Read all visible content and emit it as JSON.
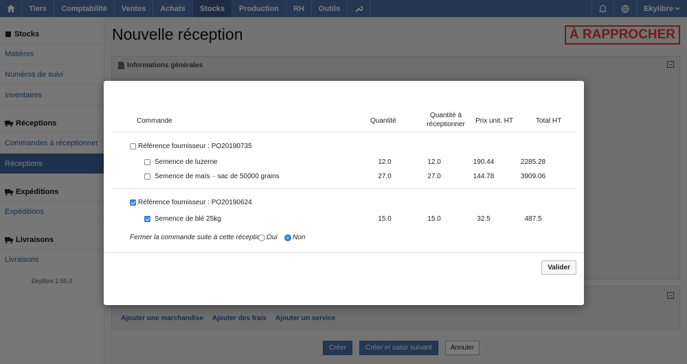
{
  "topnav": {
    "items": [
      "Tiers",
      "Comptabilité",
      "Ventes",
      "Achats",
      "Stocks",
      "Production",
      "RH",
      "Outils"
    ],
    "active": "Stocks",
    "user": "Ekylibre"
  },
  "sidebar": {
    "sections": [
      {
        "title": "Stocks",
        "items": [
          "Matières",
          "Numéros de suivi",
          "Inventaires"
        ]
      },
      {
        "title": "Réceptions",
        "items": [
          "Commandes à réceptionner",
          "Réceptions"
        ]
      },
      {
        "title": "Expéditions",
        "items": [
          "Expéditions"
        ]
      },
      {
        "title": "Livraisons",
        "items": [
          "Livraisons"
        ]
      }
    ],
    "active_item": "Réceptions",
    "version": "Ekylibre 2.55.0"
  },
  "page": {
    "title": "Nouvelle réception",
    "status": "À RAPPROCHER",
    "panel_general": "Informations générales",
    "links": [
      "Ajouter une marchandise",
      "Ajouter des frais",
      "Ajouter un service"
    ],
    "actions": {
      "create": "Créer",
      "create_next": "Créer et saisir suivant",
      "cancel": "Annuler"
    }
  },
  "modal": {
    "columns": {
      "order": "Commande",
      "quantity": "Quantité",
      "to_receive_1": "Quantité à",
      "to_receive_2": "réceptionner",
      "unit_price": "Prix unit. HT",
      "total": "Total HT"
    },
    "groups": [
      {
        "label": "Référence fournisseur : PO20190735",
        "checked": false,
        "lines": [
          {
            "name": "Semence de luzerne",
            "quantity": "12.0",
            "to_receive": "12.0",
            "unit_price": "190.44",
            "total": "2285.28",
            "checked": false
          },
          {
            "name": "Semence de maïs",
            "variant": "sac de 50000 grains",
            "quantity": "27.0",
            "to_receive": "27.0",
            "unit_price": "144.78",
            "total": "3909.06",
            "checked": false
          }
        ]
      },
      {
        "label": "Référence fournisseur : PO20190624",
        "checked": true,
        "lines": [
          {
            "name": "Semence de blé 25kg",
            "quantity": "15.0",
            "to_receive": "15.0",
            "unit_price": "32.5",
            "total": "487.5",
            "checked": true
          }
        ]
      }
    ],
    "close_order": {
      "question": "Fermer la commande suite à cette réception :",
      "yes": "Oui",
      "no": "Non",
      "selected": "Non"
    },
    "validate": "Valider"
  },
  "icons": {
    "home": "home-icon",
    "tools": "wrench-icon",
    "bell": "bell-icon",
    "globe": "globe-icon",
    "stocks": "box-icon",
    "receptions": "truck-icon",
    "shipments": "truck-icon",
    "deliveries": "truck-icon",
    "document": "document-icon"
  },
  "colors": {
    "nav": "#4a6fa5",
    "nav_active": "#3a5889",
    "link": "#2f5a96",
    "stamp": "#d63a3a",
    "checkbox": "#3b88e0"
  }
}
